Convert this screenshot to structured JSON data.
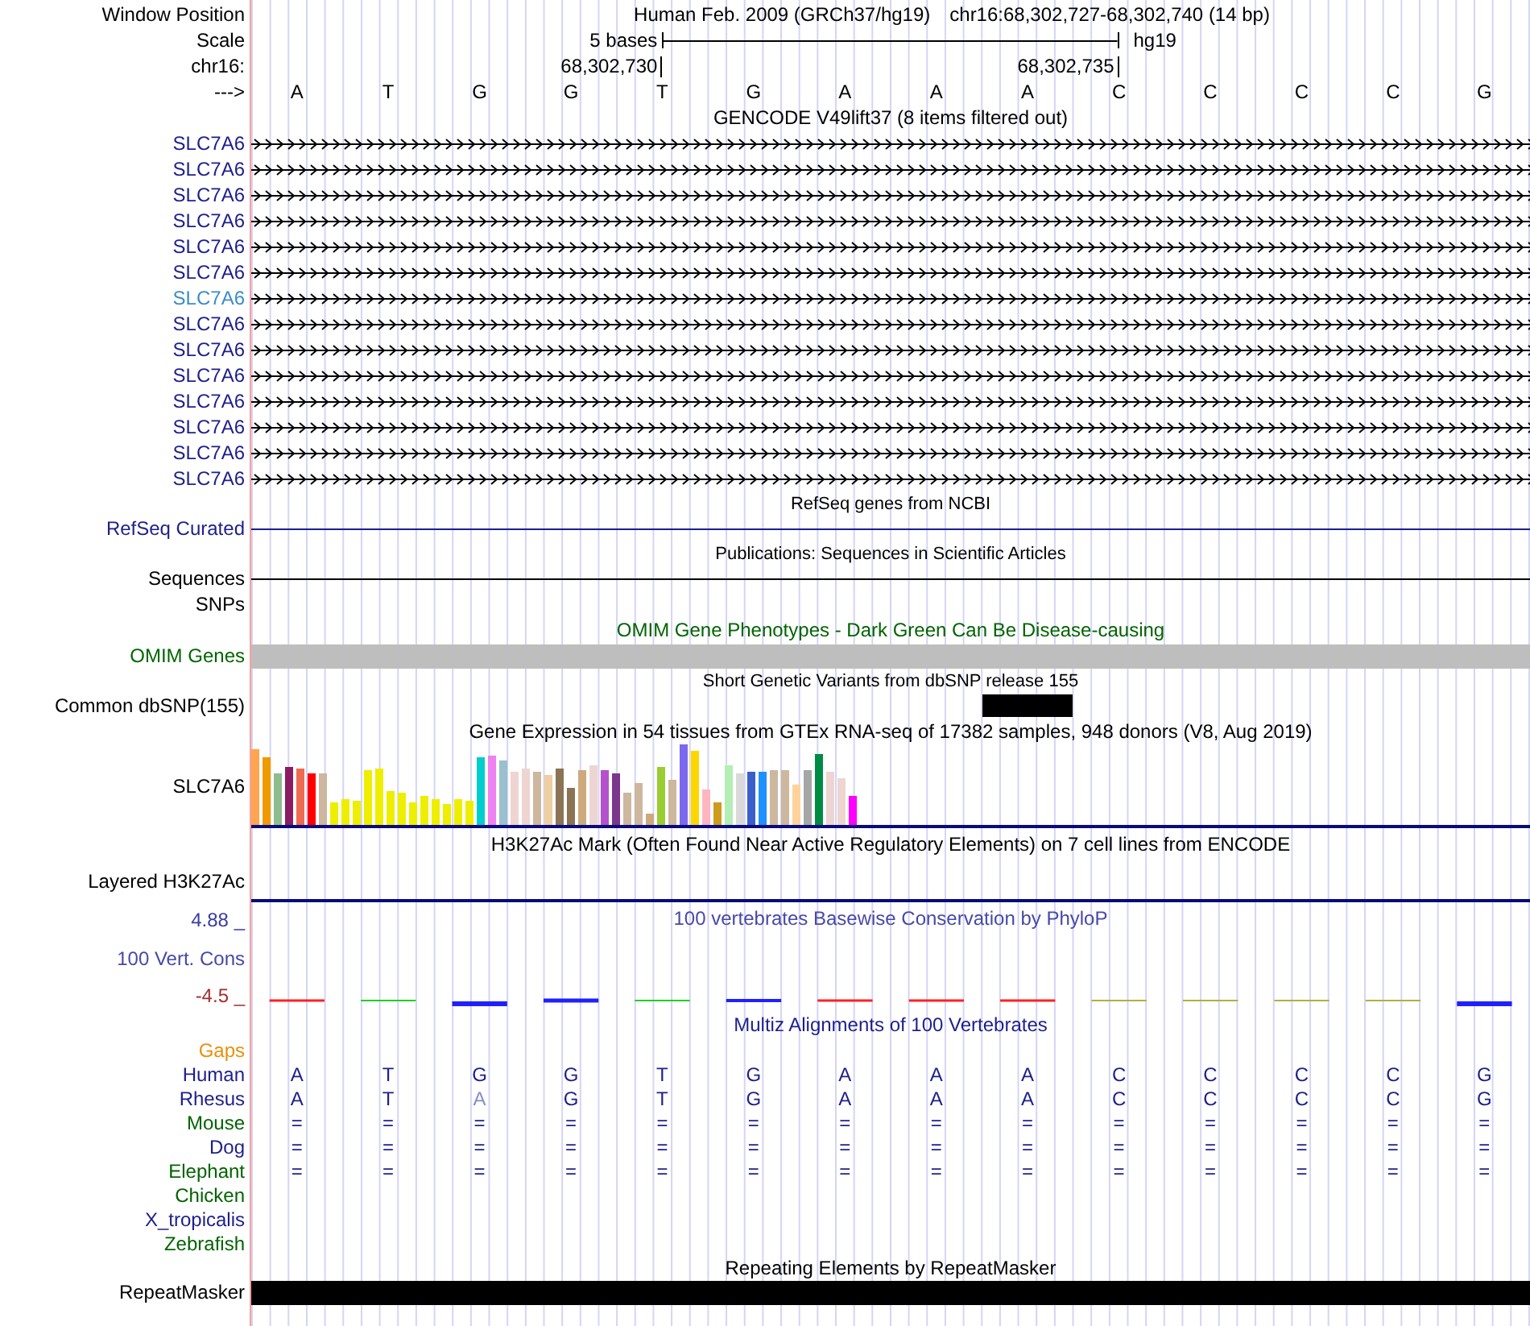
{
  "header": {
    "position_label": "Window Position",
    "assembly": "Human Feb. 2009 (GRCh37/hg19)",
    "range": "chr16:68,302,727-68,302,740 (14 bp)",
    "scale_label": "Scale",
    "scale_size": "5 bases",
    "scale_db": "hg19",
    "chrom_label": "chr16:",
    "strand_label": "--->",
    "bases": [
      {
        "letter": "A"
      },
      {
        "letter": "T"
      },
      {
        "letter": "G"
      },
      {
        "letter": "G"
      },
      {
        "letter": "T",
        "tick": "68,302,730"
      },
      {
        "letter": "G"
      },
      {
        "letter": "A"
      },
      {
        "letter": "A"
      },
      {
        "letter": "A"
      },
      {
        "letter": "C",
        "tick": "68,302,735"
      },
      {
        "letter": "C"
      },
      {
        "letter": "C"
      },
      {
        "letter": "C"
      },
      {
        "letter": "G"
      }
    ]
  },
  "tracks": [
    {
      "kind": "genes",
      "title": "GENCODE V49lift37 (8 items filtered out)",
      "items": [
        {
          "name": "SLC7A6",
          "color": "#1e1e8c"
        },
        {
          "name": "SLC7A6",
          "color": "#1e1e8c"
        },
        {
          "name": "SLC7A6",
          "color": "#1e1e8c"
        },
        {
          "name": "SLC7A6",
          "color": "#1e1e8c"
        },
        {
          "name": "SLC7A6",
          "color": "#1e1e8c"
        },
        {
          "name": "SLC7A6",
          "color": "#1e1e8c"
        },
        {
          "name": "SLC7A6",
          "color": "#3c8cc8"
        },
        {
          "name": "SLC7A6",
          "color": "#1e1e8c"
        },
        {
          "name": "SLC7A6",
          "color": "#1e1e8c"
        },
        {
          "name": "SLC7A6",
          "color": "#1e1e8c"
        },
        {
          "name": "SLC7A6",
          "color": "#1e1e8c"
        },
        {
          "name": "SLC7A6",
          "color": "#1e1e8c"
        },
        {
          "name": "SLC7A6",
          "color": "#1e1e8c"
        },
        {
          "name": "SLC7A6",
          "color": "#1e1e8c"
        }
      ]
    },
    {
      "kind": "line",
      "title": "RefSeq genes from NCBI",
      "label": "RefSeq Curated",
      "color": "#1e1e8c"
    },
    {
      "kind": "line",
      "title": "Publications: Sequences in Scientific Articles",
      "label": "Sequences",
      "color": "#000000"
    },
    {
      "kind": "empty",
      "label": "SNPs",
      "color": "#000000"
    },
    {
      "kind": "omim",
      "title": {
        "text": "OMIM Gene Phenotypes - Dark Green Can Be Disease-causing",
        "color": "#006400"
      },
      "label": "OMIM Genes",
      "color": "#006400"
    },
    {
      "kind": "snp",
      "title": "Short Genetic Variants from dbSNP release 155",
      "label": "Common dbSNP(155)",
      "color": "#000000",
      "cells": [
        {
          "variant": false
        },
        {
          "variant": false
        },
        {
          "variant": false
        },
        {
          "variant": false
        },
        {
          "variant": false
        },
        {
          "variant": false
        },
        {
          "variant": false
        },
        {
          "variant": false
        },
        {
          "variant": true
        },
        {
          "variant": false
        },
        {
          "variant": false
        },
        {
          "variant": false
        },
        {
          "variant": false
        },
        {
          "variant": false
        }
      ]
    },
    {
      "kind": "expression",
      "title": "Gene Expression in 54 tissues from GTEx RNA-seq of 17382 samples, 948 donors (V8, Aug 2019)",
      "label": "SLC7A6",
      "color": "#000000"
    },
    {
      "kind": "layered",
      "title": "H3K27Ac Mark (Often Found Near Active Regulatory Elements) on 7 cell lines from ENCODE",
      "label": "Layered H3K27Ac",
      "color": "#000000"
    },
    {
      "kind": "conservation",
      "title": {
        "text": "100 vertebrates Basewise Conservation by PhyloP",
        "color": "#4848a8"
      },
      "label": "100 Vert. Cons",
      "color": "#4848a8",
      "max": "4.88 _",
      "min": "-4.5 _"
    },
    {
      "kind": "alignment",
      "title": {
        "text": "Multiz Alignments of 100 Vertebrates",
        "color": "#1e1e8c"
      },
      "species": [
        {
          "name": "Gaps",
          "color": "#e8900c"
        },
        {
          "name": "Human",
          "color": "#1e1e8c",
          "bases": [
            {
              "text": "A",
              "differs": false
            },
            {
              "text": "T",
              "differs": false
            },
            {
              "text": "G",
              "differs": false
            },
            {
              "text": "G",
              "differs": false
            },
            {
              "text": "T",
              "differs": false
            },
            {
              "text": "G",
              "differs": false
            },
            {
              "text": "A",
              "differs": false
            },
            {
              "text": "A",
              "differs": false
            },
            {
              "text": "A",
              "differs": false
            },
            {
              "text": "C",
              "differs": false
            },
            {
              "text": "C",
              "differs": false
            },
            {
              "text": "C",
              "differs": false
            },
            {
              "text": "C",
              "differs": false
            },
            {
              "text": "G",
              "differs": false
            }
          ]
        },
        {
          "name": "Rhesus",
          "color": "#1e1e8c",
          "bases": [
            {
              "text": "A",
              "differs": false
            },
            {
              "text": "T",
              "differs": false
            },
            {
              "text": "A",
              "differs": true
            },
            {
              "text": "G",
              "differs": false
            },
            {
              "text": "T",
              "differs": false
            },
            {
              "text": "G",
              "differs": false
            },
            {
              "text": "A",
              "differs": false
            },
            {
              "text": "A",
              "differs": false
            },
            {
              "text": "A",
              "differs": false
            },
            {
              "text": "C",
              "differs": false
            },
            {
              "text": "C",
              "differs": false
            },
            {
              "text": "C",
              "differs": false
            },
            {
              "text": "C",
              "differs": false
            },
            {
              "text": "G",
              "differs": false
            }
          ]
        },
        {
          "name": "Mouse",
          "color": "#006400",
          "bases": [
            {
              "text": "=",
              "differs": false
            },
            {
              "text": "=",
              "differs": false
            },
            {
              "text": "=",
              "differs": false
            },
            {
              "text": "=",
              "differs": false
            },
            {
              "text": "=",
              "differs": false
            },
            {
              "text": "=",
              "differs": false
            },
            {
              "text": "=",
              "differs": false
            },
            {
              "text": "=",
              "differs": false
            },
            {
              "text": "=",
              "differs": false
            },
            {
              "text": "=",
              "differs": false
            },
            {
              "text": "=",
              "differs": false
            },
            {
              "text": "=",
              "differs": false
            },
            {
              "text": "=",
              "differs": false
            },
            {
              "text": "=",
              "differs": false
            }
          ]
        },
        {
          "name": "Dog",
          "color": "#1e1e8c",
          "bases": [
            {
              "text": "=",
              "differs": false
            },
            {
              "text": "=",
              "differs": false
            },
            {
              "text": "=",
              "differs": false
            },
            {
              "text": "=",
              "differs": false
            },
            {
              "text": "=",
              "differs": false
            },
            {
              "text": "=",
              "differs": false
            },
            {
              "text": "=",
              "differs": false
            },
            {
              "text": "=",
              "differs": false
            },
            {
              "text": "=",
              "differs": false
            },
            {
              "text": "=",
              "differs": false
            },
            {
              "text": "=",
              "differs": false
            },
            {
              "text": "=",
              "differs": false
            },
            {
              "text": "=",
              "differs": false
            },
            {
              "text": "=",
              "differs": false
            }
          ]
        },
        {
          "name": "Elephant",
          "color": "#006400",
          "bases": [
            {
              "text": "=",
              "differs": false
            },
            {
              "text": "=",
              "differs": false
            },
            {
              "text": "=",
              "differs": false
            },
            {
              "text": "=",
              "differs": false
            },
            {
              "text": "=",
              "differs": false
            },
            {
              "text": "=",
              "differs": false
            },
            {
              "text": "=",
              "differs": false
            },
            {
              "text": "=",
              "differs": false
            },
            {
              "text": "=",
              "differs": false
            },
            {
              "text": "=",
              "differs": false
            },
            {
              "text": "=",
              "differs": false
            },
            {
              "text": "=",
              "differs": false
            },
            {
              "text": "=",
              "differs": false
            },
            {
              "text": "=",
              "differs": false
            }
          ]
        },
        {
          "name": "Chicken",
          "color": "#006400"
        },
        {
          "name": "X_tropicalis",
          "color": "#1e1e8c"
        },
        {
          "name": "Zebrafish",
          "color": "#006400"
        }
      ]
    },
    {
      "kind": "repeat",
      "title": "Repeating Elements by RepeatMasker",
      "label": "RepeatMasker",
      "color": "#000000"
    }
  ]
}
